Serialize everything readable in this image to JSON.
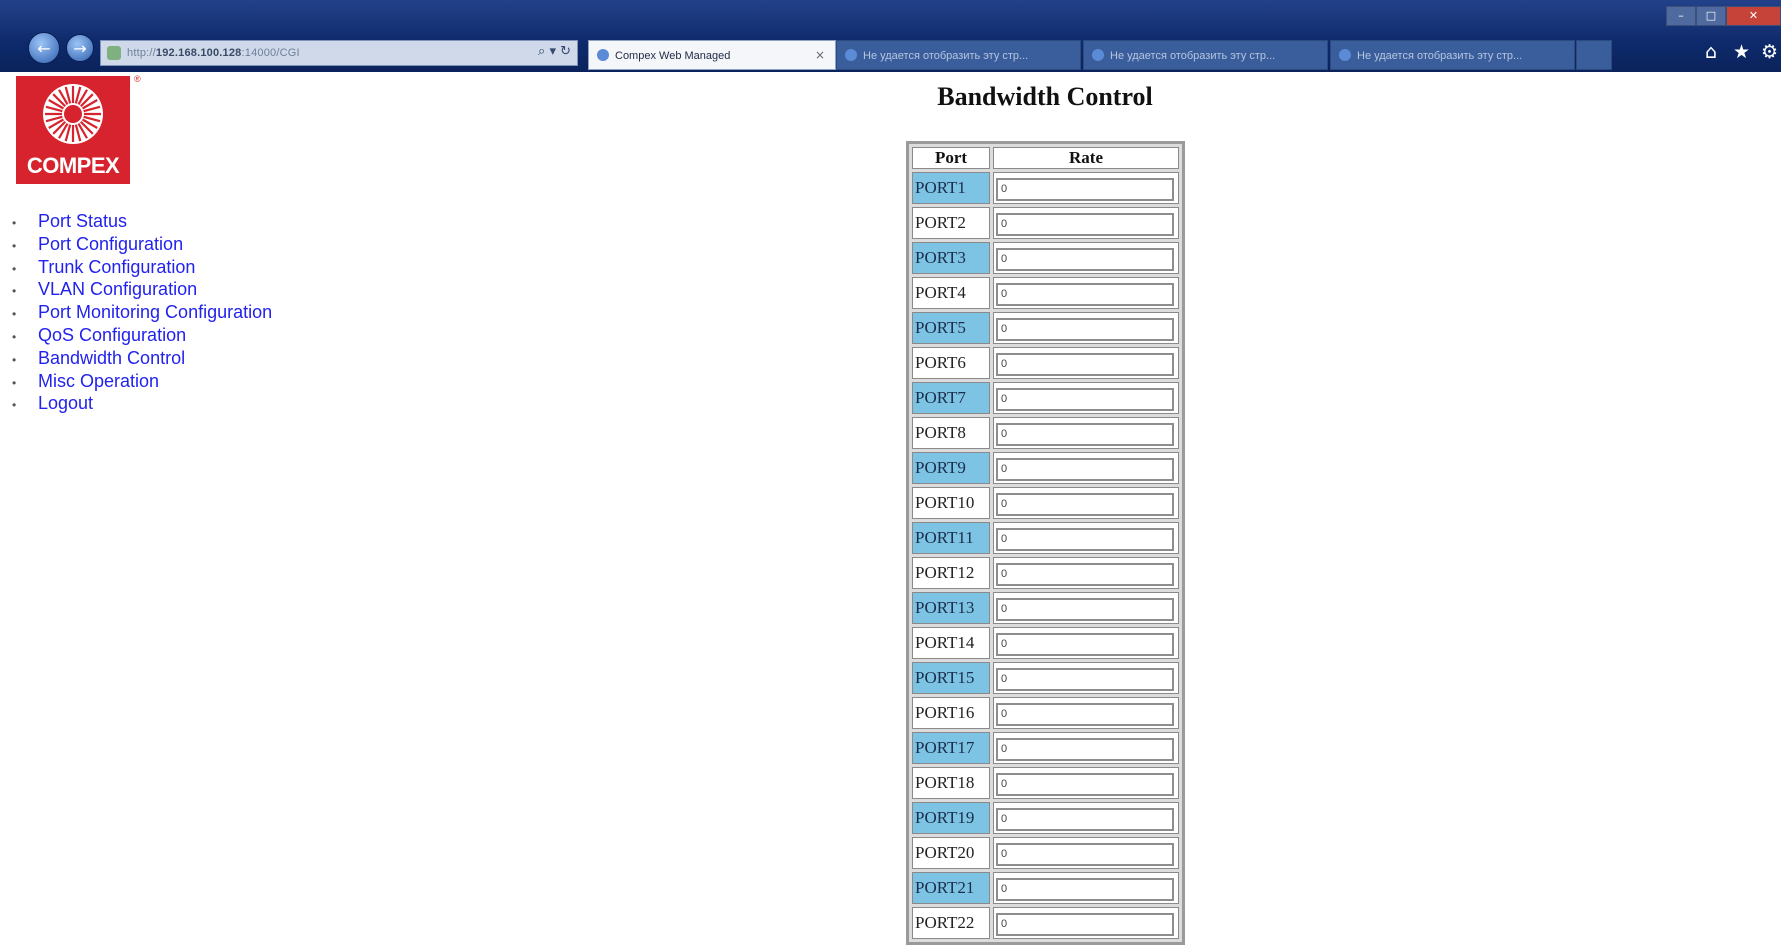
{
  "browser": {
    "address_prefix": "http://",
    "address_host": "192.168.100.128",
    "address_suffix": ":14000/CGI",
    "address_controls": "⌕ ▾ ↻",
    "tabs": [
      {
        "title": "Compex Web Managed",
        "active": true
      },
      {
        "title": "Не удается отобразить эту стр...",
        "active": false
      },
      {
        "title": "Не удается отобразить эту стр...",
        "active": false
      },
      {
        "title": "Не удается отобразить эту стр...",
        "active": false
      }
    ],
    "tab_close": "×",
    "toolbar": {
      "home": "⌂",
      "favorites": "★",
      "tools": "⚙"
    },
    "window": {
      "min": "–",
      "max": "□",
      "close": "✕"
    },
    "nav": {
      "back": "←",
      "forward": "→"
    }
  },
  "logo": {
    "brand": "COMPEX",
    "registered": "®",
    "colors": {
      "red": "#d7232d",
      "white": "#ffffff"
    }
  },
  "menu": [
    "Port Status",
    "Port Configuration",
    "Trunk Configuration",
    "VLAN Configuration",
    "Port Monitoring Configuration",
    "QoS Configuration",
    "Bandwidth Control",
    "Misc Operation",
    "Logout"
  ],
  "main": {
    "title": "Bandwidth Control",
    "columns": {
      "port": "Port",
      "rate": "Rate"
    },
    "highlight_color": "#7dc4e4",
    "rows": [
      {
        "port": "PORT1",
        "rate": "0",
        "highlight": true
      },
      {
        "port": "PORT2",
        "rate": "0",
        "highlight": false
      },
      {
        "port": "PORT3",
        "rate": "0",
        "highlight": true
      },
      {
        "port": "PORT4",
        "rate": "0",
        "highlight": false
      },
      {
        "port": "PORT5",
        "rate": "0",
        "highlight": true
      },
      {
        "port": "PORT6",
        "rate": "0",
        "highlight": false
      },
      {
        "port": "PORT7",
        "rate": "0",
        "highlight": true
      },
      {
        "port": "PORT8",
        "rate": "0",
        "highlight": false
      },
      {
        "port": "PORT9",
        "rate": "0",
        "highlight": true
      },
      {
        "port": "PORT10",
        "rate": "0",
        "highlight": false
      },
      {
        "port": "PORT11",
        "rate": "0",
        "highlight": true
      },
      {
        "port": "PORT12",
        "rate": "0",
        "highlight": false
      },
      {
        "port": "PORT13",
        "rate": "0",
        "highlight": true
      },
      {
        "port": "PORT14",
        "rate": "0",
        "highlight": false
      },
      {
        "port": "PORT15",
        "rate": "0",
        "highlight": true
      },
      {
        "port": "PORT16",
        "rate": "0",
        "highlight": false
      },
      {
        "port": "PORT17",
        "rate": "0",
        "highlight": true
      },
      {
        "port": "PORT18",
        "rate": "0",
        "highlight": false
      },
      {
        "port": "PORT19",
        "rate": "0",
        "highlight": true
      },
      {
        "port": "PORT20",
        "rate": "0",
        "highlight": false
      },
      {
        "port": "PORT21",
        "rate": "0",
        "highlight": true
      },
      {
        "port": "PORT22",
        "rate": "0",
        "highlight": false
      }
    ]
  }
}
